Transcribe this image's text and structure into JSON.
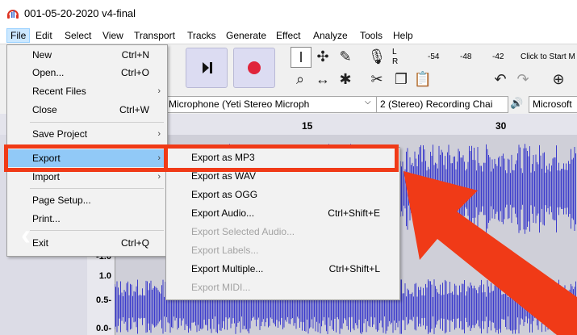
{
  "window": {
    "title": "001-05-20-2020 v4-final"
  },
  "menubar": [
    "File",
    "Edit",
    "Select",
    "View",
    "Transport",
    "Tracks",
    "Generate",
    "Effect",
    "Analyze",
    "Tools",
    "Help"
  ],
  "meter": {
    "channel_l": "L",
    "channel_r": "R",
    "scale": [
      "-54",
      "-48",
      "-42"
    ],
    "hint": "Click to Start M"
  },
  "devices": {
    "mic": "Microphone (Yeti Stereo Microph",
    "channels": "2 (Stereo) Recording Chai",
    "output": "Microsoft"
  },
  "ruler": {
    "t15": "15",
    "t30": "30"
  },
  "scale": {
    "a": "-1.0",
    "b": "1.0",
    "c": "0.5-",
    "d": "0.0-"
  },
  "file_menu": {
    "new": "New",
    "new_sc": "Ctrl+N",
    "open": "Open...",
    "open_sc": "Ctrl+O",
    "recent": "Recent Files",
    "close": "Close",
    "close_sc": "Ctrl+W",
    "save": "Save Project",
    "export": "Export",
    "import": "Import",
    "page_setup": "Page Setup...",
    "print": "Print...",
    "exit": "Exit",
    "exit_sc": "Ctrl+Q"
  },
  "export_menu": {
    "mp3": "Export as MP3",
    "wav": "Export as WAV",
    "ogg": "Export as OGG",
    "audio": "Export Audio...",
    "audio_sc": "Ctrl+Shift+E",
    "selected": "Export Selected Audio...",
    "labels": "Export Labels...",
    "multiple": "Export Multiple...",
    "multiple_sc": "Ctrl+Shift+L",
    "midi": "Export MIDI..."
  },
  "colors": {
    "highlight": "#f03a17",
    "waveform": "#3c3ccc",
    "menu_hover": "#91c9f7"
  }
}
